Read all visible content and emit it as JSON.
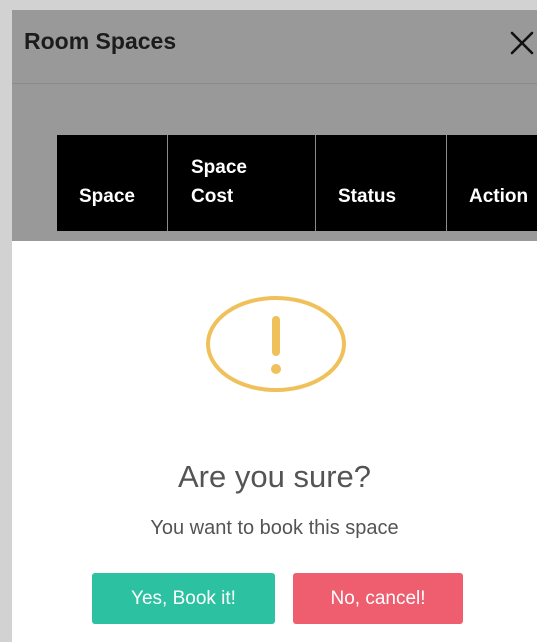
{
  "modal": {
    "title": "Room Spaces",
    "close_icon": "close-icon"
  },
  "table": {
    "headers": [
      {
        "line1": "",
        "line2": "Space"
      },
      {
        "line1": "Space",
        "line2": "Cost"
      },
      {
        "line1": "",
        "line2": "Status"
      },
      {
        "line1": "",
        "line2": "Action"
      }
    ]
  },
  "alert": {
    "icon": "warning-icon",
    "icon_color": "#f0c05a",
    "title": "Are you sure?",
    "text": "You want to book this space",
    "confirm_label": "Yes, Book it!",
    "confirm_color": "#2bc1a1",
    "cancel_label": "No, cancel!",
    "cancel_color": "#ee5e6e"
  }
}
